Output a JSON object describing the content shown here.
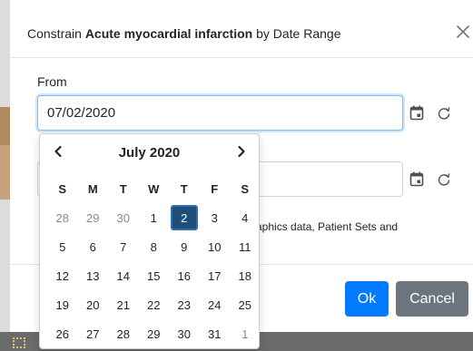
{
  "dialog": {
    "title_prefix": "Constrain ",
    "title_concept": "Acute myocardial infarction",
    "title_suffix": " by Date Range"
  },
  "from": {
    "label": "From",
    "value": "07/02/2020"
  },
  "to": {
    "value": ""
  },
  "body_text_partial": "aphics data, Patient Sets and",
  "buttons": {
    "ok": "Ok",
    "cancel": "Cancel"
  },
  "calendar": {
    "month_label": "July 2020",
    "prev_symbol": "<",
    "next_symbol": ">",
    "weekdays": [
      "S",
      "M",
      "T",
      "W",
      "T",
      "F",
      "S"
    ],
    "selected_day": "2",
    "weeks": [
      [
        {
          "d": "28",
          "muted": true
        },
        {
          "d": "29",
          "muted": true
        },
        {
          "d": "30",
          "muted": true
        },
        {
          "d": "1"
        },
        {
          "d": "2",
          "selected": true
        },
        {
          "d": "3"
        },
        {
          "d": "4"
        }
      ],
      [
        {
          "d": "5"
        },
        {
          "d": "6"
        },
        {
          "d": "7"
        },
        {
          "d": "8"
        },
        {
          "d": "9"
        },
        {
          "d": "10"
        },
        {
          "d": "11"
        }
      ],
      [
        {
          "d": "12"
        },
        {
          "d": "13"
        },
        {
          "d": "14"
        },
        {
          "d": "15"
        },
        {
          "d": "16"
        },
        {
          "d": "17"
        },
        {
          "d": "18"
        }
      ],
      [
        {
          "d": "19"
        },
        {
          "d": "20"
        },
        {
          "d": "21"
        },
        {
          "d": "22"
        },
        {
          "d": "23"
        },
        {
          "d": "24"
        },
        {
          "d": "25"
        }
      ],
      [
        {
          "d": "26"
        },
        {
          "d": "27"
        },
        {
          "d": "28"
        },
        {
          "d": "29"
        },
        {
          "d": "30"
        },
        {
          "d": "31"
        },
        {
          "d": "1",
          "muted": true
        }
      ]
    ]
  },
  "icons": {
    "close": "close-icon",
    "calendar": "calendar-icon",
    "reset": "reset-icon"
  },
  "colors": {
    "primary": "#007bff",
    "secondary": "#6c757d",
    "selected_day": "#1f4e79",
    "focus_border": "#80bdff"
  }
}
